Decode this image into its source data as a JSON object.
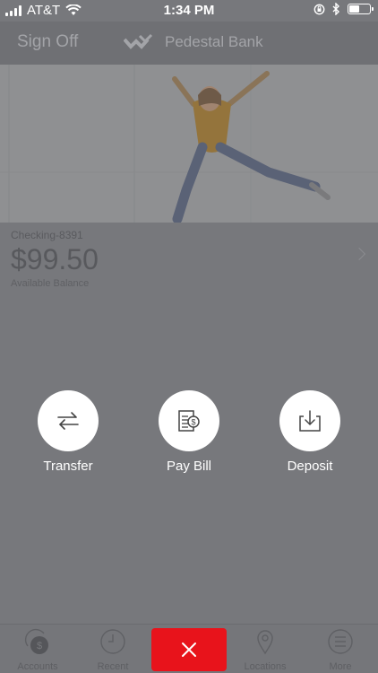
{
  "status_bar": {
    "carrier": "AT&T",
    "time": "1:34 PM",
    "battery_level": 0.45,
    "icons": [
      "signal-icon",
      "wifi-icon",
      "orientation-lock-icon",
      "bluetooth-icon",
      "battery-icon"
    ]
  },
  "nav": {
    "sign_off": "Sign Off",
    "bank_name": "Pedestal Bank"
  },
  "hero": {
    "image_alt": "woman-jumping-photo"
  },
  "account": {
    "name": "Checking-8391",
    "balance": "$99.50",
    "balance_label": "Available Balance"
  },
  "actions": [
    {
      "label": "Transfer",
      "icon": "transfer-icon"
    },
    {
      "label": "Pay Bill",
      "icon": "pay-bill-icon"
    },
    {
      "label": "Deposit",
      "icon": "deposit-icon"
    }
  ],
  "tabs": [
    {
      "label": "Accounts",
      "icon": "accounts-icon"
    },
    {
      "label": "Recent",
      "icon": "clock-icon"
    },
    {
      "label": "Locations",
      "icon": "location-pin-icon"
    },
    {
      "label": "More",
      "icon": "menu-icon"
    }
  ],
  "colors": {
    "overlay_bg": "#77787c",
    "close_button": "#e8131b",
    "action_circle": "#ffffff"
  }
}
